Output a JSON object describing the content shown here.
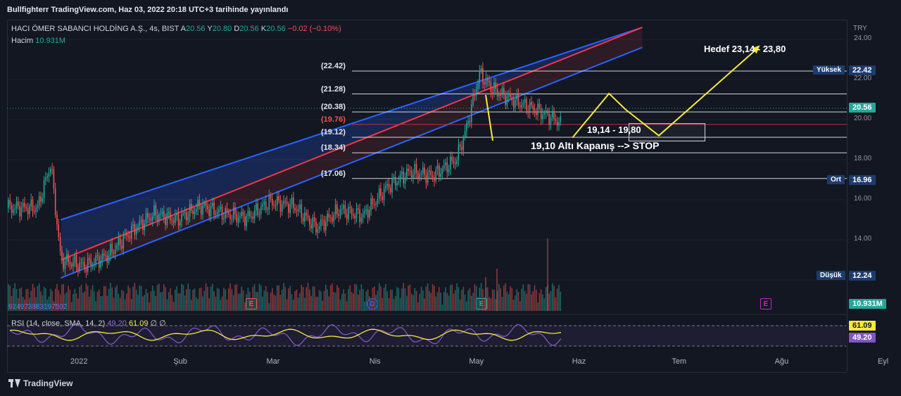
{
  "header": {
    "title": "Bullfighterr TradingView.com, Haz 03, 2022 20:18 UTC+3 tarihinde yayınlandı"
  },
  "legend": {
    "symbol": "HACI ÖMER SABANCI HOLDİNG A.Ş., 4s, BIST",
    "open_label": "A",
    "open": "20.56",
    "high_label": "Y",
    "high": "20.80",
    "low_label": "D",
    "low": "20.56",
    "close_label": "K",
    "close": "20.56",
    "change": "−0.02 (−0.10%)",
    "volume_label": "Hacim",
    "volume": "10.931M"
  },
  "rsi": {
    "label": "RSI (14, close, SMA, 14, 2)",
    "rsi_value": "49.20",
    "sma_value": "61.09",
    "extra": "∅ ∅",
    "badge_sma": "61.09",
    "badge_rsi": "49.20"
  },
  "volume_badge": "10.931M",
  "volume_id": "924973883197502",
  "axis": {
    "currency": "TRY",
    "ticks": [
      "24.00",
      "22.00",
      "20.00",
      "18.00",
      "16.00",
      "14.00",
      "12.00"
    ],
    "x_ticks": [
      "2022",
      "Şub",
      "Mar",
      "Nis",
      "May",
      "Haz",
      "Tem",
      "Ağu",
      "Eyl"
    ]
  },
  "price_badges": {
    "high_label": "Yüksek",
    "high_value": "22.42",
    "last_value": "20.56",
    "mid_label": "Ort",
    "mid_value": "16.96",
    "low_label": "Düşük",
    "low_value": "12.24"
  },
  "fib_labels": [
    "(22.42)",
    "(21.28)",
    "(20.38)",
    "(19.76)",
    "(19.12)",
    "(18.34)",
    "(17.06)"
  ],
  "annotations": {
    "target": "Hedef 23,14 - 23,80",
    "zone": "19,14 - 19,80",
    "stop": "19,10 Altı Kapanış --> STOP"
  },
  "events": [
    "E",
    "D",
    "E",
    "E"
  ],
  "footer": {
    "brand": "TradingView"
  },
  "colors": {
    "up": "#26a69a",
    "down": "#ef5350",
    "channel_blue": "#2962ff",
    "channel_red": "#f23645",
    "drawing": "#f7e93a",
    "rsi": "#7e57c2"
  },
  "chart_data": {
    "type": "candlestick",
    "timeframe": "4s",
    "x_ticks": [
      "2022",
      "Şub",
      "Mar",
      "Nis",
      "May",
      "Haz",
      "Tem",
      "Ağu",
      "Eyl"
    ],
    "ylim": [
      11.7,
      24.6
    ],
    "y_ticks": [
      12,
      14,
      16,
      18,
      20,
      22,
      24
    ],
    "price_path": [
      [
        "2021-12-20",
        15.6
      ],
      [
        "2021-12-24",
        17.8
      ],
      [
        "2021-12-27",
        13.0
      ],
      [
        "2022-01-03",
        12.7
      ],
      [
        "2022-01-10",
        13.2
      ],
      [
        "2022-01-17",
        14.4
      ],
      [
        "2022-01-24",
        15.3
      ],
      [
        "2022-01-31",
        15.0
      ],
      [
        "2022-02-07",
        15.7
      ],
      [
        "2022-02-14",
        15.3
      ],
      [
        "2022-02-21",
        15.1
      ],
      [
        "2022-02-28",
        15.9
      ],
      [
        "2022-03-07",
        15.7
      ],
      [
        "2022-03-14",
        14.6
      ],
      [
        "2022-03-21",
        15.5
      ],
      [
        "2022-03-28",
        15.2
      ],
      [
        "2022-04-04",
        16.6
      ],
      [
        "2022-04-11",
        17.4
      ],
      [
        "2022-04-18",
        17.2
      ],
      [
        "2022-04-25",
        18.0
      ],
      [
        "2022-04-28",
        19.5
      ],
      [
        "2022-05-02",
        22.3
      ],
      [
        "2022-05-06",
        21.5
      ],
      [
        "2022-05-13",
        20.9
      ],
      [
        "2022-05-20",
        20.4
      ],
      [
        "2022-05-25",
        20.0
      ],
      [
        "2022-05-30",
        19.1
      ],
      [
        "2022-06-05",
        19.7
      ],
      [
        "2022-06-10",
        20.6
      ],
      [
        "2022-06-15",
        21.3
      ],
      [
        "2022-06-20",
        20.56
      ]
    ],
    "horizontal_levels": [
      22.42,
      21.28,
      20.38,
      19.76,
      19.12,
      18.34,
      17.06
    ],
    "channel": {
      "upper": [
        [
          "2021-12-27",
          15.0
        ],
        [
          "2022-06-20",
          24.6
        ]
      ],
      "mid": [
        [
          "2021-12-27",
          13.0
        ],
        [
          "2022-06-20",
          24.6
        ]
      ],
      "lower": [
        [
          "2021-12-27",
          12.1
        ],
        [
          "2022-06-20",
          23.6
        ]
      ]
    },
    "projection": [
      [
        "2022-05-30",
        19.1
      ],
      [
        "2022-06-10",
        21.3
      ],
      [
        "2022-06-15",
        20.5
      ],
      [
        "2022-06-25",
        19.2
      ],
      [
        "2022-07-25",
        23.6
      ]
    ],
    "rsi": {
      "levels": [
        70,
        30
      ],
      "rsi_last": 49.2,
      "sma_last": 61.09
    }
  }
}
